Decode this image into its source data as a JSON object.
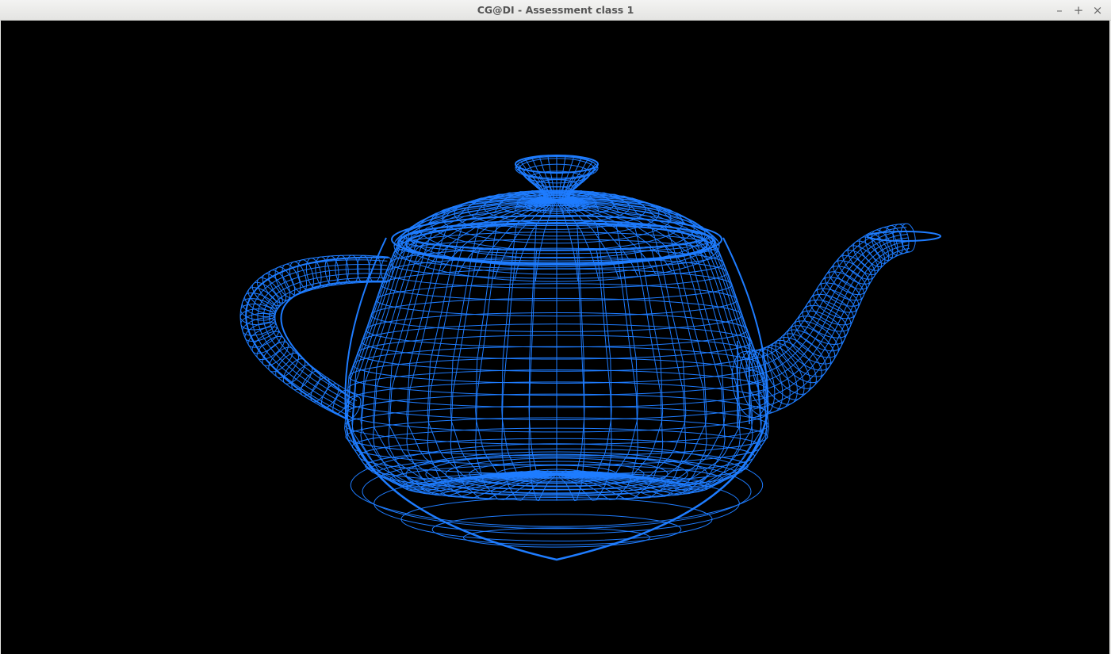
{
  "window": {
    "title": "CG@DI - Assessment class 1",
    "controls": {
      "minimize": "–",
      "maximize": "+",
      "close": "×"
    }
  },
  "scene": {
    "background_color": "#000000",
    "wire_color": "#1e7cff",
    "object": "teapot",
    "render_mode": "wireframe"
  }
}
